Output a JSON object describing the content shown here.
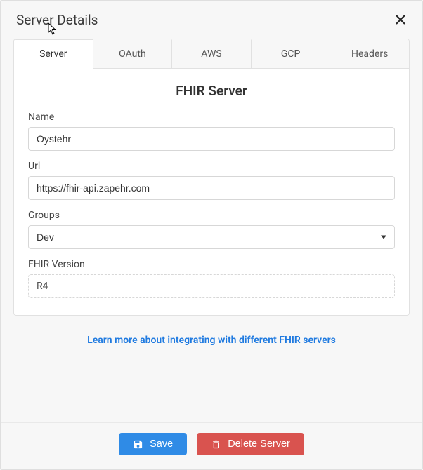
{
  "modal": {
    "title": "Server Details"
  },
  "tabs": [
    {
      "label": "Server"
    },
    {
      "label": "OAuth"
    },
    {
      "label": "AWS"
    },
    {
      "label": "GCP"
    },
    {
      "label": "Headers"
    }
  ],
  "section": {
    "title": "FHIR Server"
  },
  "form": {
    "name": {
      "label": "Name",
      "value": "Oystehr"
    },
    "url": {
      "label": "Url",
      "value": "https://fhir-api.zapehr.com"
    },
    "groups": {
      "label": "Groups",
      "value": "Dev"
    },
    "version": {
      "label": "FHIR Version",
      "value": "R4"
    }
  },
  "learn_more": {
    "text": "Learn more about integrating with different FHIR servers"
  },
  "footer": {
    "save": "Save",
    "delete": "Delete Server"
  }
}
